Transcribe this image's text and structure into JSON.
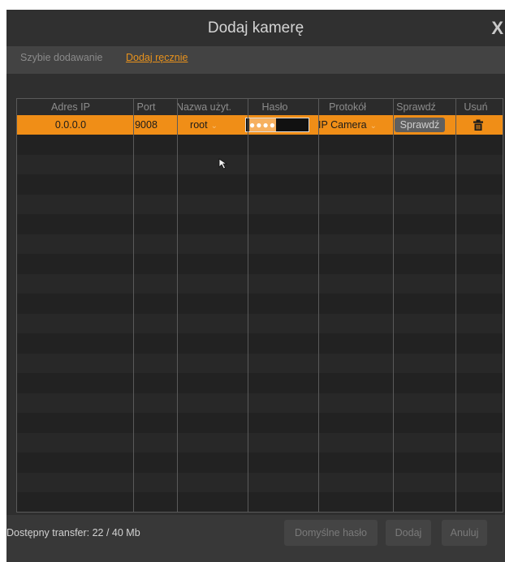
{
  "dialog": {
    "title": "Dodaj kamerę",
    "close_glyph": "X"
  },
  "tabs": {
    "quick": "Szybie dodawanie",
    "manual": "Dodaj ręcznie"
  },
  "table": {
    "headers": [
      "Adres IP",
      "Port",
      "Nazwa użyt.",
      "Hasło",
      "Protokół",
      "Sprawdź",
      "Usuń"
    ],
    "row": {
      "ip": "0.0.0.0",
      "port": "9008",
      "user": "root",
      "password_mask": "●●●●",
      "protocol": "IP Camera",
      "check_label": "Sprawdź",
      "delete_icon": "trash-icon"
    }
  },
  "footer": {
    "transfer": "Dostępny transfer: 22 / 40 Mb",
    "default_password": "Domyślne hasło",
    "add": "Dodaj",
    "cancel": "Anuluj"
  },
  "colors": {
    "accent": "#f08e17",
    "background": "#383838"
  }
}
